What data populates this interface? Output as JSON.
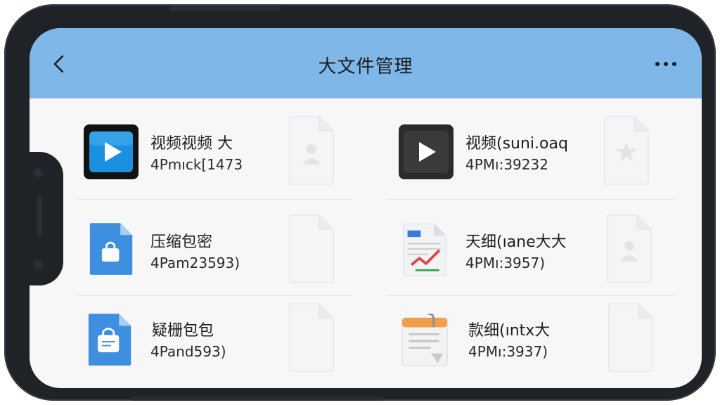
{
  "header": {
    "title": "大文件管理"
  },
  "files": [
    {
      "name": "视频视频  大",
      "meta": "4Pmıck[1473",
      "type": "video-blue",
      "doc_icon": "person-icon"
    },
    {
      "name": "视频(suni.oaq",
      "meta": "4PMı:39232",
      "type": "video-dark",
      "doc_icon": "star-icon"
    },
    {
      "name": "压缩包密",
      "meta": "4Pam23593)",
      "type": "archive-blue",
      "doc_icon": "blank"
    },
    {
      "name": "天细(ıane大大",
      "meta": "4PMı:3957)",
      "type": "spreadsheet",
      "doc_icon": "person-icon"
    },
    {
      "name": "疑栅包包",
      "meta": "4Pand593)",
      "type": "archive-blue-2",
      "doc_icon": "blank"
    },
    {
      "name": "款细(ıntx大",
      "meta": "4PMı:3937)",
      "type": "notes",
      "doc_icon": "blank"
    }
  ],
  "colors": {
    "header": "#7fb7e8",
    "screen": "#f7f7f8",
    "frame": "#1f2226"
  }
}
